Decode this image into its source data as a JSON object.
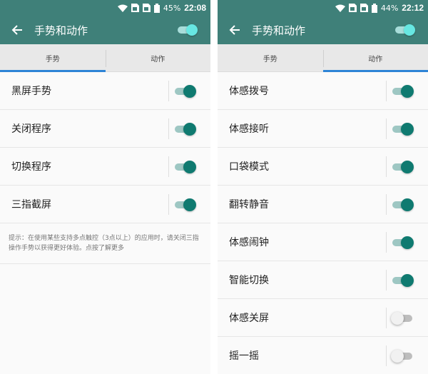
{
  "colors": {
    "bar": "#3f8079",
    "accent": "#0f7a70",
    "tab_indicator": "#2d84d6"
  },
  "left": {
    "status": {
      "battery": "45%",
      "time": "22:08"
    },
    "title": "手势和动作",
    "tabs": [
      {
        "label": "手势"
      },
      {
        "label": "动作"
      }
    ],
    "active_tab": 0,
    "items": [
      {
        "label": "黑屏手势",
        "on": true
      },
      {
        "label": "关闭程序",
        "on": true
      },
      {
        "label": "切换程序",
        "on": true
      },
      {
        "label": "三指截屏",
        "on": true
      }
    ],
    "hint": "提示：在使用某些支持多点触控（3点以上）的应用时，请关闭三指操作手势以获得更好体验。点按了解更多"
  },
  "right": {
    "status": {
      "battery": "44%",
      "time": "22:12"
    },
    "title": "手势和动作",
    "tabs": [
      {
        "label": "手势"
      },
      {
        "label": "动作"
      }
    ],
    "active_tab": 1,
    "items": [
      {
        "label": "体感拨号",
        "on": true
      },
      {
        "label": "体感接听",
        "on": true
      },
      {
        "label": "口袋模式",
        "on": true
      },
      {
        "label": "翻转静音",
        "on": true
      },
      {
        "label": "体感闹钟",
        "on": true
      },
      {
        "label": "智能切换",
        "on": true
      },
      {
        "label": "体感关屏",
        "on": false
      },
      {
        "label": "摇一摇",
        "on": false
      }
    ]
  }
}
